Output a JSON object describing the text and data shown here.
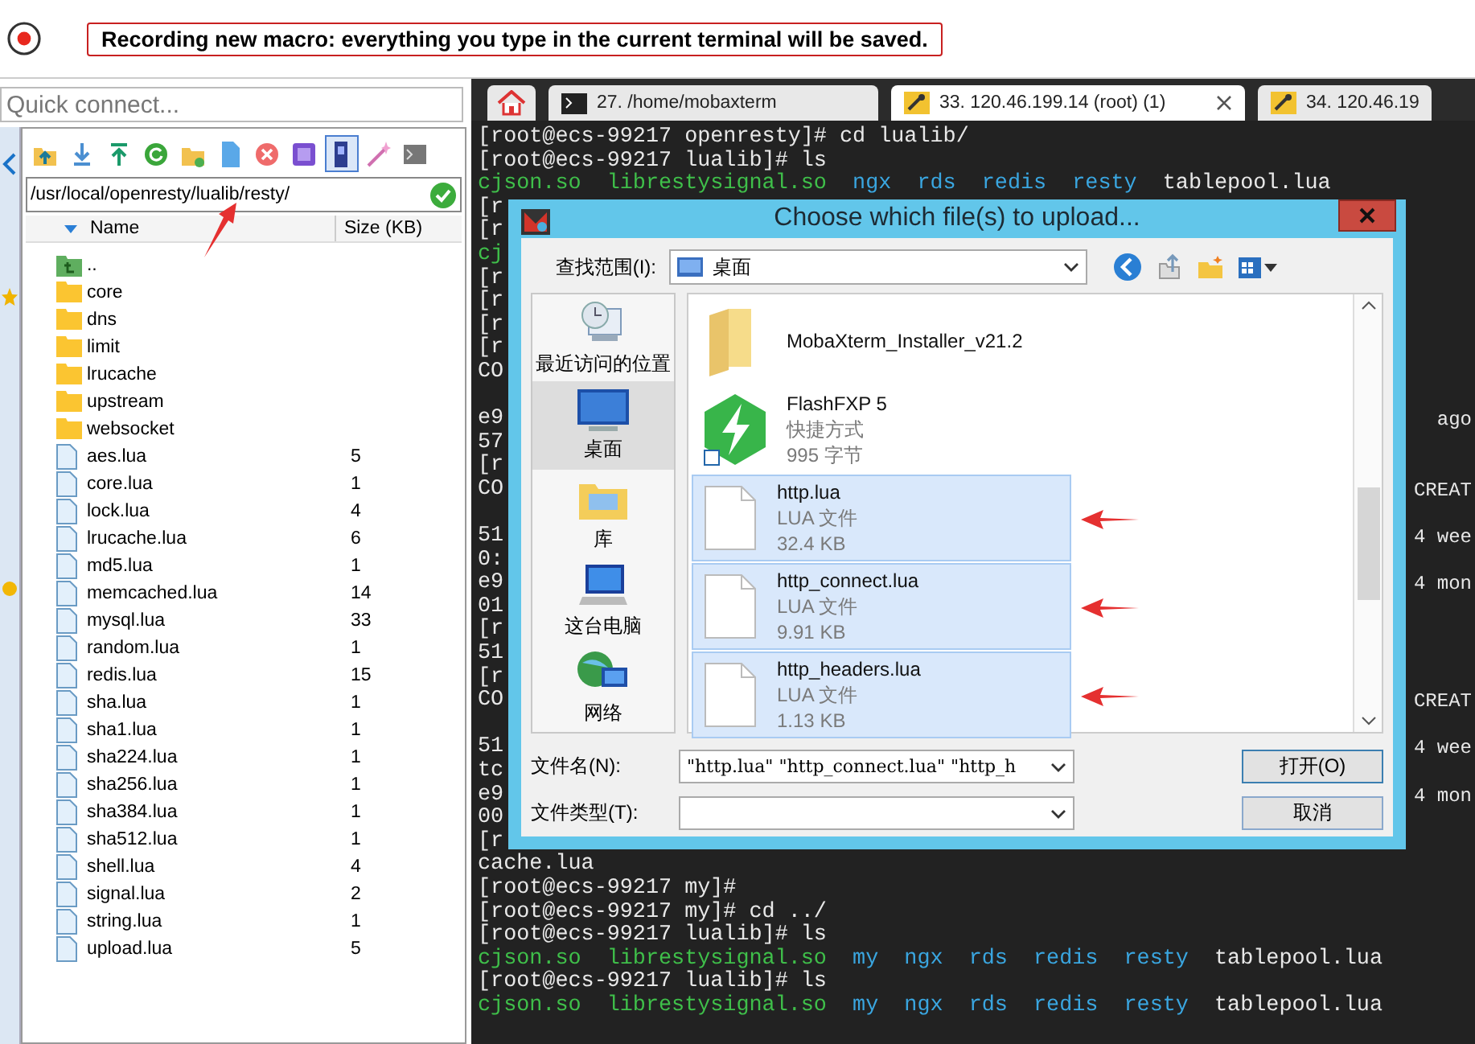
{
  "macro_banner": "Recording new macro: everything you type in the current terminal will be saved.",
  "quick_connect": {
    "placeholder": "Quick connect..."
  },
  "file_toolbar": [
    {
      "kind": "up-folder",
      "on": false
    },
    {
      "kind": "download",
      "on": false
    },
    {
      "kind": "upload",
      "on": false
    },
    {
      "kind": "refresh",
      "on": false
    },
    {
      "kind": "new-folder",
      "on": false
    },
    {
      "kind": "new-file",
      "on": false
    },
    {
      "kind": "delete",
      "on": false
    },
    {
      "kind": "format",
      "on": false
    },
    {
      "kind": "follow-terminal",
      "on": true
    },
    {
      "kind": "wand",
      "on": false
    },
    {
      "kind": "terminal",
      "on": false
    }
  ],
  "path": "/usr/local/openresty/lualib/resty/",
  "file_columns": [
    "Name",
    "Size (KB)"
  ],
  "files": [
    {
      "name": "..",
      "kind": "up"
    },
    {
      "name": "core",
      "kind": "folder"
    },
    {
      "name": "dns",
      "kind": "folder"
    },
    {
      "name": "limit",
      "kind": "folder"
    },
    {
      "name": "lrucache",
      "kind": "folder"
    },
    {
      "name": "upstream",
      "kind": "folder"
    },
    {
      "name": "websocket",
      "kind": "folder"
    },
    {
      "name": "aes.lua",
      "kind": "file",
      "size": "5"
    },
    {
      "name": "core.lua",
      "kind": "file",
      "size": "1"
    },
    {
      "name": "lock.lua",
      "kind": "file",
      "size": "4"
    },
    {
      "name": "lrucache.lua",
      "kind": "file",
      "size": "6"
    },
    {
      "name": "md5.lua",
      "kind": "file",
      "size": "1"
    },
    {
      "name": "memcached.lua",
      "kind": "file",
      "size": "14"
    },
    {
      "name": "mysql.lua",
      "kind": "file",
      "size": "33"
    },
    {
      "name": "random.lua",
      "kind": "file",
      "size": "1"
    },
    {
      "name": "redis.lua",
      "kind": "file",
      "size": "15"
    },
    {
      "name": "sha.lua",
      "kind": "file",
      "size": "1"
    },
    {
      "name": "sha1.lua",
      "kind": "file",
      "size": "1"
    },
    {
      "name": "sha224.lua",
      "kind": "file",
      "size": "1"
    },
    {
      "name": "sha256.lua",
      "kind": "file",
      "size": "1"
    },
    {
      "name": "sha384.lua",
      "kind": "file",
      "size": "1"
    },
    {
      "name": "sha512.lua",
      "kind": "file",
      "size": "1"
    },
    {
      "name": "shell.lua",
      "kind": "file",
      "size": "4"
    },
    {
      "name": "signal.lua",
      "kind": "file",
      "size": "2"
    },
    {
      "name": "string.lua",
      "kind": "file",
      "size": "1"
    },
    {
      "name": "upload.lua",
      "kind": "file",
      "size": "5"
    }
  ],
  "tabs": [
    {
      "kind": "home",
      "selected": false
    },
    {
      "kind": "local",
      "label": "27. /home/mobaxterm",
      "selected": false
    },
    {
      "kind": "ssh",
      "label": "33. 120.46.199.14 (root) (1)",
      "selected": true
    },
    {
      "kind": "ssh",
      "label": "34. 120.46.19",
      "selected": false
    }
  ],
  "terminal_lines": [
    {
      "kind": "text",
      "segments": [
        {
          "text": "[root@ecs-99217 openresty]# cd lualib/",
          "kind": "plain"
        }
      ]
    },
    {
      "kind": "text",
      "segments": [
        {
          "text": "[root@ecs-99217 lualib]# ls",
          "kind": "plain"
        }
      ]
    },
    {
      "kind": "text",
      "segments": [
        {
          "text": "cjson.so",
          "kind": "exec"
        },
        {
          "text": "librestysignal.so",
          "kind": "exec"
        },
        {
          "text": "ngx",
          "kind": "dir"
        },
        {
          "text": "rds",
          "kind": "dir"
        },
        {
          "text": "redis",
          "kind": "dir"
        },
        {
          "text": "resty",
          "kind": "dir"
        },
        {
          "text": "tablepool.lua",
          "kind": "plain"
        }
      ]
    },
    {
      "kind": "text",
      "segments": [
        {
          "text": "[r",
          "kind": "plain"
        }
      ]
    },
    {
      "kind": "text",
      "segments": [
        {
          "text": "[r",
          "kind": "plain"
        }
      ]
    },
    {
      "kind": "text",
      "segments": [
        {
          "text": "cj",
          "kind": "exec"
        }
      ]
    },
    {
      "kind": "text",
      "segments": [
        {
          "text": "[r",
          "kind": "plain"
        }
      ]
    },
    {
      "kind": "text",
      "segments": [
        {
          "text": "[r",
          "kind": "plain"
        }
      ]
    },
    {
      "kind": "text",
      "segments": [
        {
          "text": "[r",
          "kind": "plain"
        }
      ]
    },
    {
      "kind": "text",
      "segments": [
        {
          "text": "[r",
          "kind": "plain"
        }
      ]
    },
    {
      "kind": "text",
      "segments": [
        {
          "text": "CO",
          "kind": "plain"
        }
      ]
    },
    {
      "kind": "blank"
    },
    {
      "kind": "text",
      "segments": [
        {
          "text": "e9",
          "kind": "plain"
        }
      ],
      "tail": "ago"
    },
    {
      "kind": "text",
      "segments": [
        {
          "text": "57",
          "kind": "plain"
        }
      ]
    },
    {
      "kind": "text",
      "segments": [
        {
          "text": "[r",
          "kind": "plain"
        }
      ]
    },
    {
      "kind": "text",
      "segments": [
        {
          "text": "CO",
          "kind": "plain"
        }
      ],
      "tail": "CREAT"
    },
    {
      "kind": "blank"
    },
    {
      "kind": "text",
      "segments": [
        {
          "text": "51",
          "kind": "plain"
        }
      ],
      "tail": "4 wee"
    },
    {
      "kind": "text",
      "segments": [
        {
          "text": "0:",
          "kind": "plain"
        }
      ]
    },
    {
      "kind": "text",
      "segments": [
        {
          "text": "e9",
          "kind": "plain"
        }
      ],
      "tail": "4 mon"
    },
    {
      "kind": "text",
      "segments": [
        {
          "text": "01",
          "kind": "plain"
        }
      ]
    },
    {
      "kind": "text",
      "segments": [
        {
          "text": "[r",
          "kind": "plain"
        }
      ]
    },
    {
      "kind": "text",
      "segments": [
        {
          "text": "51",
          "kind": "plain"
        }
      ]
    },
    {
      "kind": "text",
      "segments": [
        {
          "text": "[r",
          "kind": "plain"
        }
      ]
    },
    {
      "kind": "text",
      "segments": [
        {
          "text": "CO",
          "kind": "plain"
        }
      ],
      "tail": "CREAT"
    },
    {
      "kind": "blank"
    },
    {
      "kind": "text",
      "segments": [
        {
          "text": "51",
          "kind": "plain"
        }
      ],
      "tail": "4 wee"
    },
    {
      "kind": "text",
      "segments": [
        {
          "text": "tc",
          "kind": "plain"
        }
      ]
    },
    {
      "kind": "text",
      "segments": [
        {
          "text": "e9",
          "kind": "plain"
        }
      ],
      "tail": "4 mon"
    },
    {
      "kind": "text",
      "segments": [
        {
          "text": "00",
          "kind": "plain"
        }
      ]
    },
    {
      "kind": "text",
      "segments": [
        {
          "text": "[r",
          "kind": "plain"
        }
      ]
    },
    {
      "kind": "text",
      "segments": [
        {
          "text": "cache.lua",
          "kind": "plain"
        }
      ]
    },
    {
      "kind": "text",
      "segments": [
        {
          "text": "[root@ecs-99217 my]#",
          "kind": "plain"
        }
      ]
    },
    {
      "kind": "text",
      "segments": [
        {
          "text": "[root@ecs-99217 my]# cd ../",
          "kind": "plain"
        }
      ]
    },
    {
      "kind": "text",
      "segments": [
        {
          "text": "[root@ecs-99217 lualib]# ls",
          "kind": "plain"
        }
      ]
    },
    {
      "kind": "text",
      "segments": [
        {
          "text": "cjson.so",
          "kind": "exec"
        },
        {
          "text": "librestysignal.so",
          "kind": "exec"
        },
        {
          "text": "my",
          "kind": "dir"
        },
        {
          "text": "ngx",
          "kind": "dir"
        },
        {
          "text": "rds",
          "kind": "dir"
        },
        {
          "text": "redis",
          "kind": "dir"
        },
        {
          "text": "resty",
          "kind": "dir"
        },
        {
          "text": "tablepool.lua",
          "kind": "plain"
        }
      ]
    },
    {
      "kind": "text",
      "segments": [
        {
          "text": "[root@ecs-99217 lualib]# ls",
          "kind": "plain"
        }
      ]
    },
    {
      "kind": "text",
      "segments": [
        {
          "text": "cjson.so",
          "kind": "exec"
        },
        {
          "text": "librestysignal.so",
          "kind": "exec"
        },
        {
          "text": "my",
          "kind": "dir"
        },
        {
          "text": "ngx",
          "kind": "dir"
        },
        {
          "text": "rds",
          "kind": "dir"
        },
        {
          "text": "redis",
          "kind": "dir"
        },
        {
          "text": "resty",
          "kind": "dir"
        },
        {
          "text": "tablepool.lua",
          "kind": "plain"
        }
      ]
    }
  ],
  "dialog": {
    "title": "Choose which file(s) to upload...",
    "look_in_label": "查找范围(I):",
    "look_in": "桌面",
    "places": [
      {
        "kind": "recent",
        "label": "最近访问的位置",
        "selected": false
      },
      {
        "kind": "desktop",
        "label": "桌面",
        "selected": true
      },
      {
        "kind": "library",
        "label": "库",
        "selected": false
      },
      {
        "kind": "computer",
        "label": "这台电脑",
        "selected": false
      },
      {
        "kind": "network",
        "label": "网络",
        "selected": false
      }
    ],
    "files": [
      {
        "kind": "folder",
        "name": "MobaXterm_Installer_v21.2",
        "selected": false
      },
      {
        "kind": "shortcut",
        "name": "FlashFXP 5",
        "details": [
          "快捷方式",
          "995 字节"
        ],
        "selected": false
      },
      {
        "kind": "document",
        "name": "http.lua",
        "details": [
          "LUA 文件",
          "32.4 KB"
        ],
        "selected": true
      },
      {
        "kind": "document",
        "name": "http_connect.lua",
        "details": [
          "LUA 文件",
          "9.91 KB"
        ],
        "selected": true
      },
      {
        "kind": "document",
        "name": "http_headers.lua",
        "details": [
          "LUA 文件",
          "1.13 KB"
        ],
        "selected": true
      }
    ],
    "filename_label": "文件名(N):",
    "filename": "\"http.lua\" \"http_connect.lua\" \"http_h",
    "filetype_label": "文件类型(T):",
    "open_button": "打开(O)",
    "cancel_button": "取消"
  }
}
